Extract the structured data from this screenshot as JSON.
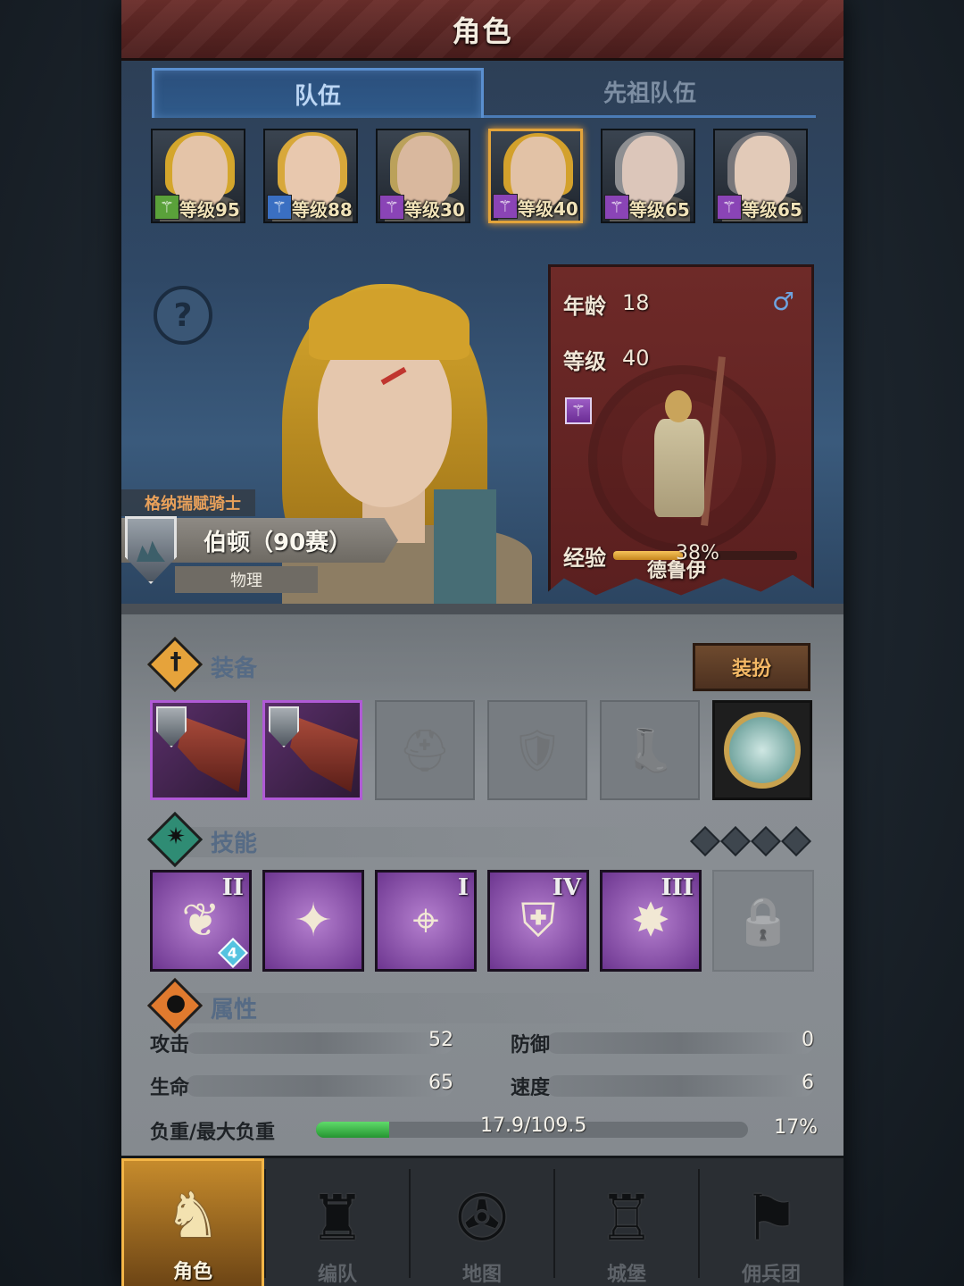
{
  "header": {
    "title": "角色"
  },
  "tabs": [
    {
      "label": "队伍",
      "active": true
    },
    {
      "label": "先祖队伍",
      "active": false
    }
  ],
  "roster": [
    {
      "level_label": "等级95",
      "class_icon": "crossed-swords-icon",
      "hair": "#d4a62c",
      "skin": "#e4c4a8",
      "cls_color": "#5aa13a",
      "selected": false
    },
    {
      "level_label": "等级88",
      "class_icon": "sword-icon",
      "hair": "#d8a83a",
      "skin": "#e8c8ae",
      "cls_color": "#3a6fc2",
      "selected": false
    },
    {
      "level_label": "等级30",
      "class_icon": "staff-icon",
      "hair": "#bba15a",
      "skin": "#d9b89e",
      "cls_color": "#8a44b6",
      "selected": false
    },
    {
      "level_label": "等级40",
      "class_icon": "staff-icon",
      "hair": "#d3a12c",
      "skin": "#e2c2a6",
      "cls_color": "#8a44b6",
      "selected": true
    },
    {
      "level_label": "等级65",
      "class_icon": "staff-icon",
      "hair": "#8e8f92",
      "skin": "#dcc6ba",
      "cls_color": "#8a44b6",
      "selected": false
    },
    {
      "level_label": "等级65",
      "class_icon": "staff-icon",
      "hair": "#77767a",
      "skin": "#e2cab8",
      "cls_color": "#8a44b6",
      "selected": false
    }
  ],
  "hero": {
    "faction": "格纳瑞赋骑士",
    "name": "伯顿（90赛）",
    "damage_type": "物理"
  },
  "info": {
    "age_label": "年龄",
    "age": "18",
    "gender": "♂",
    "level_label": "等级",
    "level": "40",
    "class_name": "德鲁伊",
    "exp_label": "经验",
    "exp_pct_text": "38%",
    "exp_pct": 38
  },
  "equipment": {
    "title": "装备",
    "dress_button": "装扮",
    "slots": [
      {
        "type": "weapon",
        "icon": "claw-weapon-icon"
      },
      {
        "type": "weapon",
        "icon": "claw-weapon-icon"
      },
      {
        "type": "empty",
        "icon": "helmet-icon",
        "glyph": "⛑"
      },
      {
        "type": "empty",
        "icon": "chest-armor-icon",
        "glyph": "🛡"
      },
      {
        "type": "empty",
        "icon": "boots-icon",
        "glyph": "👢"
      },
      {
        "type": "coin",
        "icon": "amulet-icon"
      }
    ]
  },
  "skills": {
    "title": "技能",
    "items": [
      {
        "tier": "II",
        "icon": "thorn-vine-icon",
        "glyph": "❦",
        "badge": "4"
      },
      {
        "tier": "",
        "icon": "crystal-break-icon",
        "glyph": "✦",
        "badge": ""
      },
      {
        "tier": "I",
        "icon": "target-spear-icon",
        "glyph": "⌖",
        "badge": ""
      },
      {
        "tier": "IV",
        "icon": "shield-icon",
        "glyph": "⛨",
        "badge": ""
      },
      {
        "tier": "III",
        "icon": "burst-icon",
        "glyph": "✸",
        "badge": ""
      }
    ],
    "locked_icon": "lock-icon"
  },
  "attributes": {
    "title": "属性",
    "stats": [
      {
        "key": "攻击",
        "value": "52"
      },
      {
        "key": "防御",
        "value": "0"
      },
      {
        "key": "生命",
        "value": "65"
      },
      {
        "key": "速度",
        "value": "6"
      }
    ],
    "load_label": "负重/最大负重",
    "load_text": "17.9/109.5",
    "load_pct_text": "17%",
    "load_pct": 17
  },
  "nav": [
    {
      "label": "角色",
      "icon": "knight-icon",
      "glyph": "♞",
      "active": true
    },
    {
      "label": "编队",
      "icon": "helmet-icon",
      "glyph": "♜",
      "active": false
    },
    {
      "label": "地图",
      "icon": "compass-icon",
      "glyph": "✇",
      "active": false
    },
    {
      "label": "城堡",
      "icon": "castle-icon",
      "glyph": "♖",
      "active": false
    },
    {
      "label": "佣兵团",
      "icon": "banner-icon",
      "glyph": "⚑",
      "active": false
    }
  ]
}
